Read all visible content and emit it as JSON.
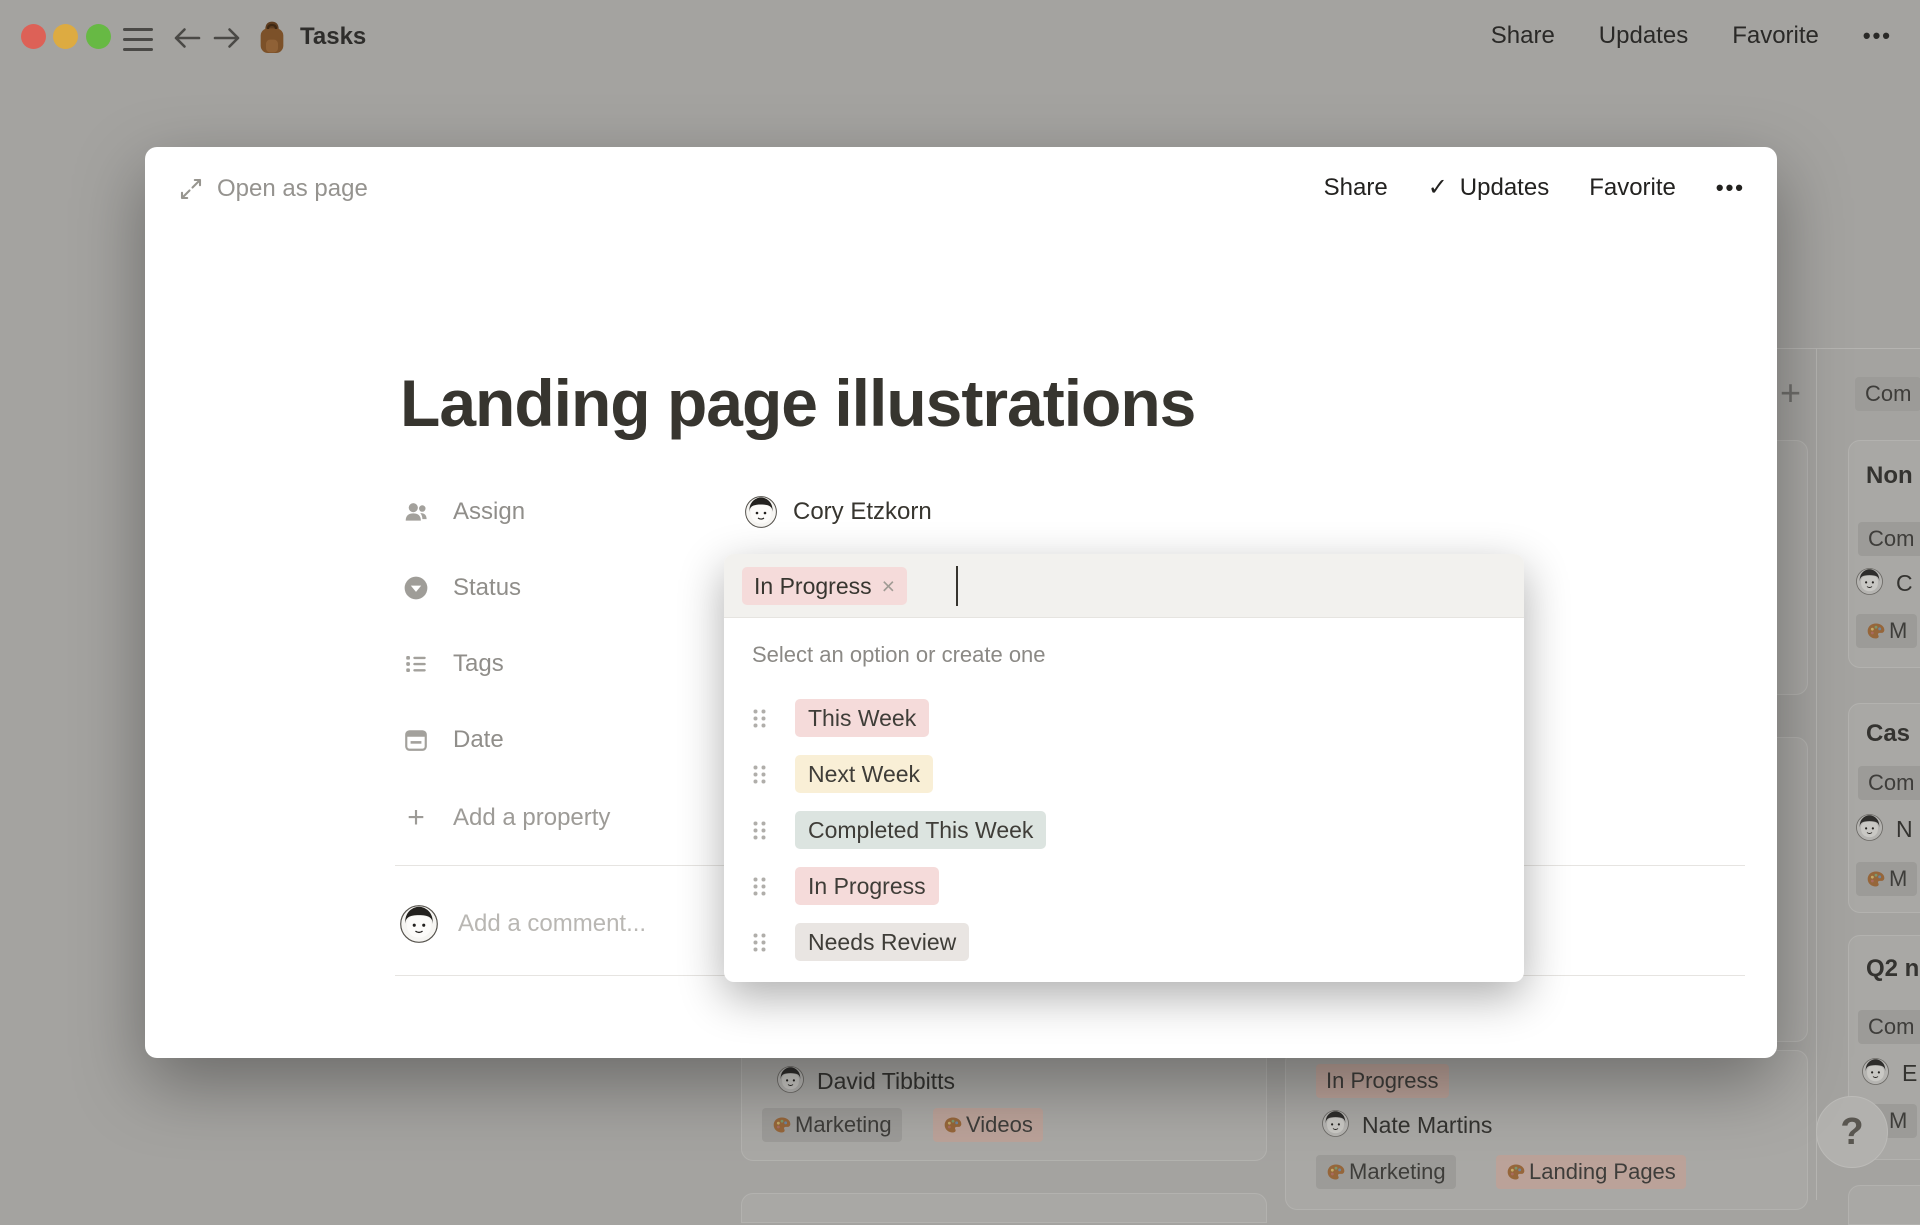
{
  "colors": {
    "overlay_background": "#a4a3a0",
    "modal_background": "#ffffff",
    "text_primary": "#37352f",
    "tag_red": "#f5dbda",
    "tag_yellow": "#f9efd6",
    "tag_green": "#dce4e0",
    "tag_gray": "#e9e5e2",
    "dim_tag_gray": "#9c9b98",
    "dim_tag_pink": "#bba299",
    "traffic_red": "#dd6157",
    "traffic_yellow": "#ddab41",
    "traffic_green": "#67b944"
  },
  "topbar": {
    "title": "Tasks",
    "share": "Share",
    "updates": "Updates",
    "favorite": "Favorite",
    "more": "•••"
  },
  "modal": {
    "open_as_page": "Open as page",
    "share": "Share",
    "updates_check": "✓",
    "updates": "Updates",
    "favorite": "Favorite",
    "more": "•••",
    "title": "Landing page illustrations",
    "properties": {
      "assign": "Assign",
      "status": "Status",
      "tags": "Tags",
      "date": "Date"
    },
    "assignee": "Cory Etzkorn",
    "add_property_plus": "+",
    "add_property": "Add a property",
    "add_comment": "Add a comment..."
  },
  "status_dropdown": {
    "selected": {
      "label": "In Progress",
      "remove": "×"
    },
    "hint": "Select an option or create one",
    "options": [
      {
        "label": "This Week",
        "color": "red"
      },
      {
        "label": "Next Week",
        "color": "yellow"
      },
      {
        "label": "Completed This Week",
        "color": "green"
      },
      {
        "label": "In Progress",
        "color": "red"
      },
      {
        "label": "Needs Review",
        "color": "gray"
      }
    ]
  },
  "board": {
    "add_column": "+",
    "column_header": "Com",
    "middle_card": {
      "name": "David Tibbitts",
      "tags": [
        {
          "label": "Marketing",
          "color": "gray"
        },
        {
          "label": "Videos",
          "color": "pink"
        }
      ]
    },
    "status_card": {
      "status": "In Progress",
      "name": "Nate Martins",
      "tags": [
        {
          "label": "Marketing",
          "color": "gray"
        },
        {
          "label": "Landing Pages",
          "color": "pink"
        }
      ]
    },
    "right_cards": [
      {
        "title": "Non",
        "status": "Com",
        "person": "C",
        "tag": "M"
      },
      {
        "title": "Cas",
        "status": "Com",
        "person": "N",
        "tag": "M"
      },
      {
        "title": "Q2 n",
        "status": "Com",
        "person": "E",
        "tag": "M"
      }
    ]
  },
  "help": {
    "label": "?"
  }
}
